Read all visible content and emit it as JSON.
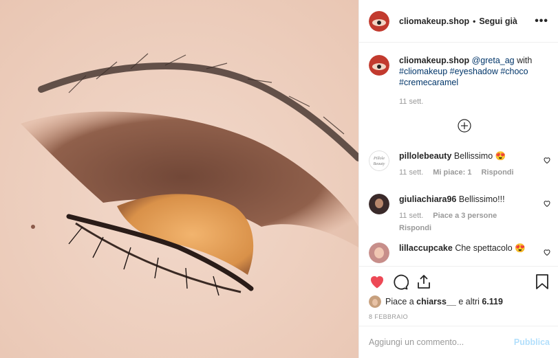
{
  "post": {
    "author": "cliomakeup.shop",
    "separator": "•",
    "follow_label": "Segui già",
    "more_label": "•••"
  },
  "caption": {
    "user": "cliomakeup.shop",
    "mention": "@greta_ag",
    "text": " with",
    "hashtags_line1": "#cliomakeup #eyeshadow #choco",
    "hashtags_line2": "#cremecaramel",
    "time": "11 sett."
  },
  "comments": [
    {
      "user": "pillolebeauty",
      "text": "Bellissimo 😍",
      "time": "11 sett.",
      "likes": "Mi piace: 1",
      "reply": "Rispondi"
    },
    {
      "user": "giuliachiara96",
      "text": "Bellissimo!!!",
      "time": "11 sett.",
      "likes": "Piace a 3 persone",
      "reply": "Rispondi"
    },
    {
      "user": "lillaccupcake",
      "text": "Che spettacolo 😍"
    }
  ],
  "likes_summary": {
    "prefix": "Piace a ",
    "user": "chiarss__",
    "suffix": " e altri ",
    "count": "6.119"
  },
  "post_date": "8 FEBBRAIO",
  "add_comment": {
    "placeholder": "Aggiungi un commento...",
    "publish_label": "Pubblica"
  },
  "colors": {
    "like_red": "#ed4956",
    "link_blue": "#003569",
    "publish_disabled": "#b2dffc"
  },
  "icons": [
    "heart-icon",
    "comment-icon",
    "share-icon",
    "bookmark-icon",
    "plus-circle-icon",
    "more-icon"
  ]
}
